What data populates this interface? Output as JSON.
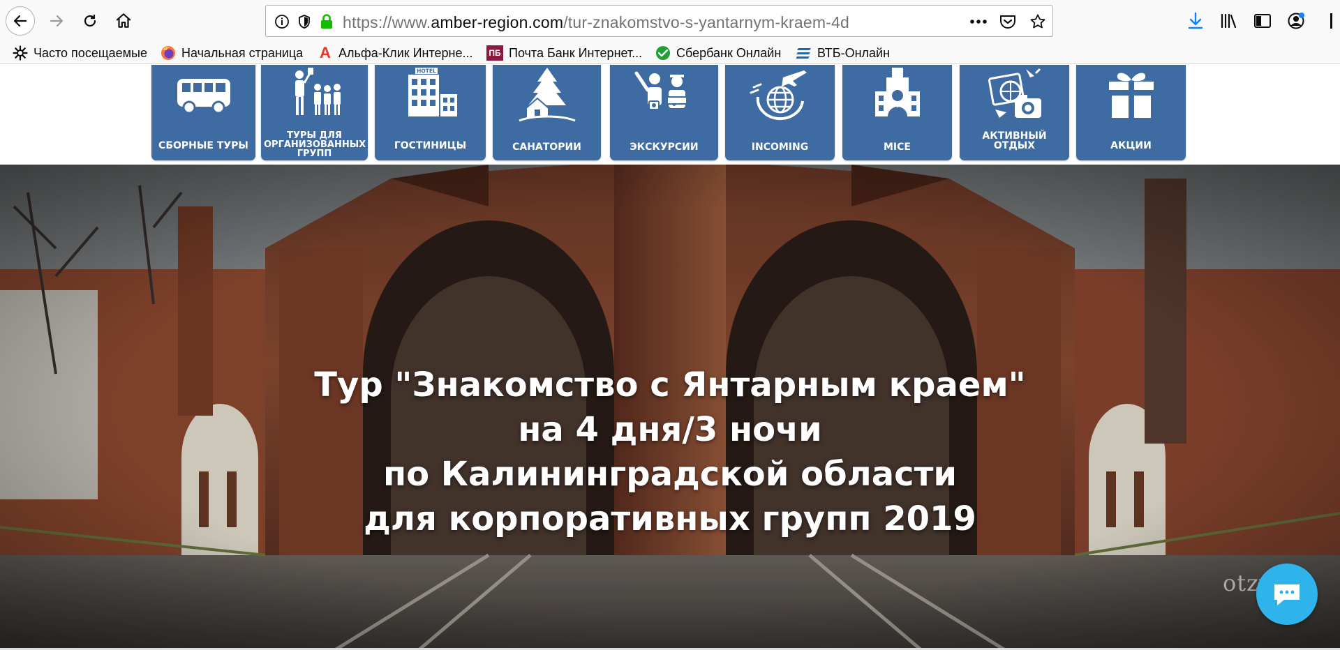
{
  "browser": {
    "url_prefix": "https://www.",
    "url_domain": "amber-region.com",
    "url_path": "/tur-znakomstvo-s-yantarnym-kraem-4d",
    "bookmarks": [
      {
        "label": "Часто посещаемые",
        "icon": "gear-icon"
      },
      {
        "label": "Начальная страница",
        "icon": "firefox-icon"
      },
      {
        "label": "Альфа-Клик Интерне...",
        "icon": "alfa-bank-icon"
      },
      {
        "label": "Почта Банк Интернет...",
        "icon": "pochta-bank-icon"
      },
      {
        "label": "Сбербанк Онлайн",
        "icon": "sberbank-icon"
      },
      {
        "label": "ВТБ-Онлайн",
        "icon": "vtb-icon"
      }
    ],
    "pochta_bank_badge": "ПБ",
    "alfa_badge": "А"
  },
  "menu": {
    "items": [
      {
        "label": "СБОРНЫЕ ТУРЫ",
        "icon": "bus-icon"
      },
      {
        "label": "ТУРЫ ДЛЯ ОРГАНИЗОВАННЫХ ГРУПП",
        "icon": "tour-group-icon"
      },
      {
        "label": "ГОСТИНИЦЫ",
        "icon": "hotel-icon"
      },
      {
        "label": "САНАТОРИИ",
        "icon": "sanatorium-icon"
      },
      {
        "label": "ЭКСКУРСИИ",
        "icon": "excursion-icon"
      },
      {
        "label": "INCOMING",
        "icon": "incoming-globe-icon"
      },
      {
        "label": "MICE",
        "icon": "mice-conference-icon"
      },
      {
        "label": "АКТИВНЫЙ ОТДЫХ",
        "icon": "active-rest-camera-icon"
      },
      {
        "label": "АКЦИИ",
        "icon": "gift-icon"
      }
    ],
    "hotel_sign": "HOTEL"
  },
  "hero": {
    "title_lines": [
      "Тур \"Знакомство с Янтарным краем\"",
      "на 4 дня/3 ночи",
      "по Калининградской области",
      "для корпоративных групп 2019"
    ],
    "image": "brandenburg-gate-photo"
  },
  "watermark": "otzyv.ru",
  "colors": {
    "tile": "#3d6ba2",
    "chat": "#2eb4ea",
    "download": "#0a84ff"
  }
}
